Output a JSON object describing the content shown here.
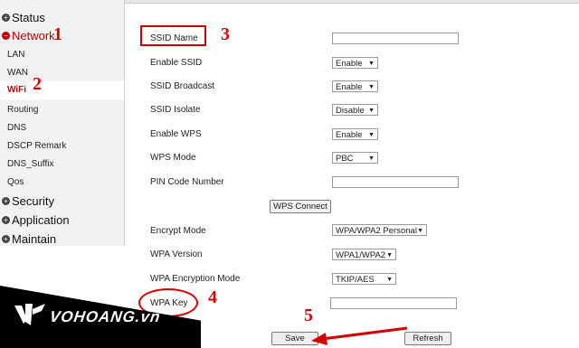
{
  "sidebar": {
    "groups": {
      "status": "Status",
      "network": "Network",
      "security": "Security",
      "application": "Application",
      "maintain": "Maintain"
    },
    "items": [
      "LAN",
      "WAN",
      "WiFi",
      "Routing",
      "DNS",
      "DSCP Remark",
      "DNS_Suffix",
      "Qos"
    ],
    "selected": "WiFi"
  },
  "form": {
    "ssid_name": {
      "label": "SSID Name",
      "value": ""
    },
    "enable_ssid": {
      "label": "Enable SSID",
      "value": "Enable"
    },
    "ssid_broadcast": {
      "label": "SSID Broadcast",
      "value": "Enable"
    },
    "ssid_isolate": {
      "label": "SSID Isolate",
      "value": "Disable"
    },
    "enable_wps": {
      "label": "Enable WPS",
      "value": "Enable"
    },
    "wps_mode": {
      "label": "WPS Mode",
      "value": "PBC"
    },
    "pin_code": {
      "label": "PIN Code Number",
      "value": ""
    },
    "wps_connect": "WPS Connect",
    "encrypt_mode": {
      "label": "Encrypt Mode",
      "value": "WPA/WPA2 Personal"
    },
    "wpa_version": {
      "label": "WPA Version",
      "value": "WPA1/WPA2"
    },
    "wpa_encryption": {
      "label": "WPA Encryption Mode",
      "value": "TKIP/AES"
    },
    "wpa_key": {
      "label": "WPA Key",
      "value": ""
    }
  },
  "buttons": {
    "save": "Save",
    "refresh": "Refresh"
  },
  "annotations": [
    "1",
    "2",
    "3",
    "4",
    "5"
  ],
  "logo": {
    "text": "VOHOANG.vn"
  },
  "colors": {
    "annotation": "#d40000",
    "active_menu": "#c00000",
    "logo_bg": "#000000"
  }
}
